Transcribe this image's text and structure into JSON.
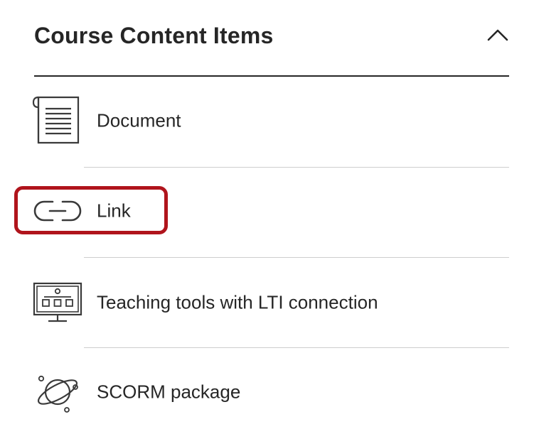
{
  "section": {
    "title": "Course Content Items",
    "collapse_icon": "chevron-up-icon"
  },
  "items": [
    {
      "label": "Document",
      "icon": "document-icon"
    },
    {
      "label": "Link",
      "icon": "link-icon",
      "highlighted": true
    },
    {
      "label": "Teaching tools with LTI connection",
      "icon": "lti-tool-icon"
    },
    {
      "label": "SCORM package",
      "icon": "scorm-icon"
    }
  ],
  "colors": {
    "text": "#262626",
    "divider": "#cdcdcd",
    "highlight": "#b0141c"
  }
}
